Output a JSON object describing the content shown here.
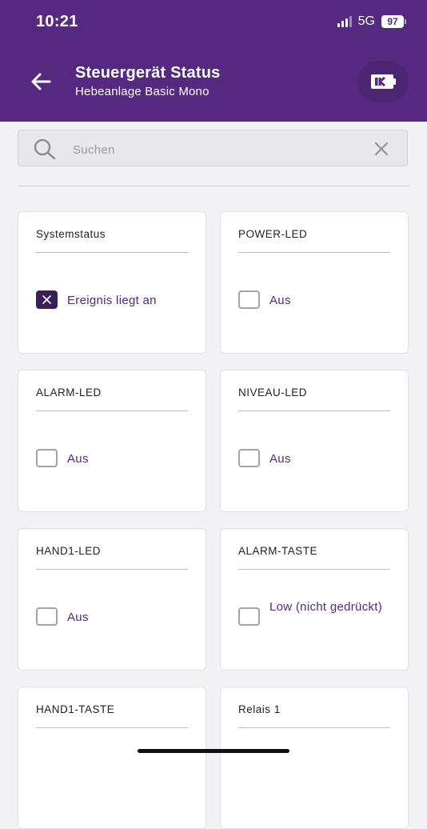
{
  "status_bar": {
    "time": "10:21",
    "network": "5G",
    "battery": "97"
  },
  "header": {
    "title": "Steuergerät Status",
    "subtitle": "Hebeanlage Basic Mono",
    "back_icon": "arrow-left-icon",
    "action_icon": "battery-device-icon"
  },
  "search": {
    "placeholder": "Suchen",
    "value": ""
  },
  "cards": [
    {
      "title": "Systemstatus",
      "value": "Ereignis liegt an",
      "checked": true
    },
    {
      "title": "POWER-LED",
      "value": "Aus",
      "checked": false
    },
    {
      "title": "ALARM-LED",
      "value": "Aus",
      "checked": false
    },
    {
      "title": "NIVEAU-LED",
      "value": "Aus",
      "checked": false
    },
    {
      "title": "HAND1-LED",
      "value": "Aus",
      "checked": false
    },
    {
      "title": "ALARM-TASTE",
      "value": "Low (nicht gedrückt)",
      "checked": false
    },
    {
      "title": "HAND1-TASTE"
    },
    {
      "title": "Relais 1"
    }
  ],
  "colors": {
    "primary": "#54297f",
    "checked": "#3d1f58",
    "background": "#f2f2f4"
  }
}
